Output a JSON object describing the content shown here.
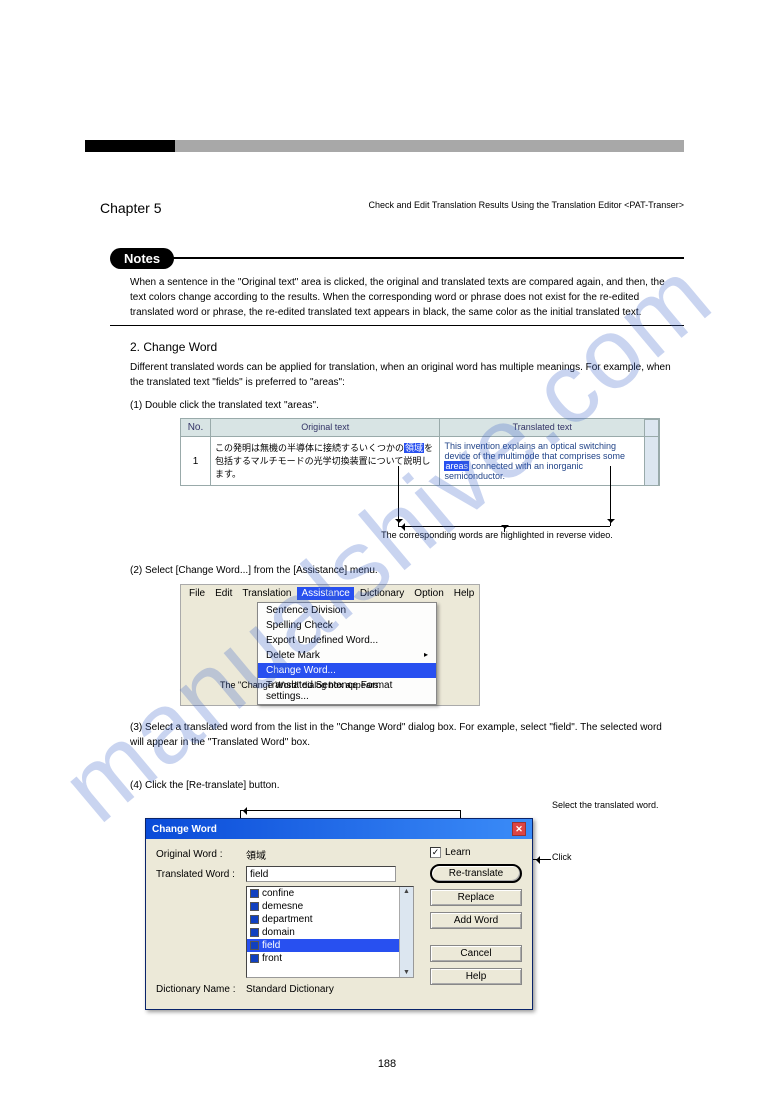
{
  "chapter": {
    "left": "Chapter 5",
    "right": "Check and Edit Translation Results Using the Translation Editor <PAT-Transer>"
  },
  "notes": {
    "label": "Notes",
    "text": "When a sentence in the \"Original text\" area is clicked, the original and translated texts are compared again, and then, the text colors change according to the results. When the corresponding word or phrase does not exist for the re-edited translated word or phrase, the re-edited translated text appears in black, the same color as the initial translated text."
  },
  "section": {
    "title": "2. Change Word",
    "intro": "Different translated words can be applied for translation, when an original word has multiple meanings. For example, when the translated text \"fields\" is preferred to \"areas\":",
    "step1": "(1) Double click the translated text \"areas\".",
    "table": {
      "headers": {
        "no": "No.",
        "orig": "Original text",
        "tran": "Translated text"
      },
      "row": {
        "no": "1",
        "orig_pre": "この発明は無機の半導体に接続するいくつかの",
        "orig_hl": "領域",
        "orig_post": "を包括するマルチモードの光学切換装置について説明します。",
        "tran_pre": "This invention explains an optical switching device of the multimode that comprises some ",
        "tran_hl": "areas",
        "tran_post": " connected with an inorganic semiconductor."
      },
      "annotation": "The corresponding words are highlighted in reverse video."
    },
    "step2": "(2) Select [Change Word...] from the [Assistance] menu.",
    "menu": {
      "items": [
        "File",
        "Edit",
        "Translation",
        "Assistance",
        "Dictionary",
        "Option",
        "Help"
      ],
      "selected": "Assistance",
      "dropdown": [
        "Sentence Division",
        "Spelling Check",
        "Export Undefined Word...",
        "Delete Mark",
        "Change Word...",
        "Translated Sentence Format settings..."
      ],
      "highlight": "Change Word...",
      "annotation": "The \"Change Word\" dialog box appears."
    },
    "step3": "(3) Select a translated word from the list in the \"Change Word\" dialog box. For example, select \"field\". The selected word will appear in the \"Translated Word\" box.",
    "step4": "(4) Click the [Re-translate] button.",
    "dialog": {
      "title": "Change Word",
      "orig_label": "Original Word :",
      "orig_value": "領域",
      "tran_label": "Translated Word :",
      "tran_value": "field",
      "list": [
        "confine",
        "demesne",
        "department",
        "domain",
        "field",
        "front"
      ],
      "list_selected": "field",
      "dict_label": "Dictionary Name :",
      "dict_value": "Standard Dictionary",
      "learn": "Learn",
      "buttons": {
        "retranslate": "Re-translate",
        "replace": "Replace",
        "addword": "Add Word",
        "cancel": "Cancel",
        "help": "Help"
      },
      "annotation_select": "Select the translated word.",
      "annotation_click": "Click"
    }
  },
  "footer": "188"
}
